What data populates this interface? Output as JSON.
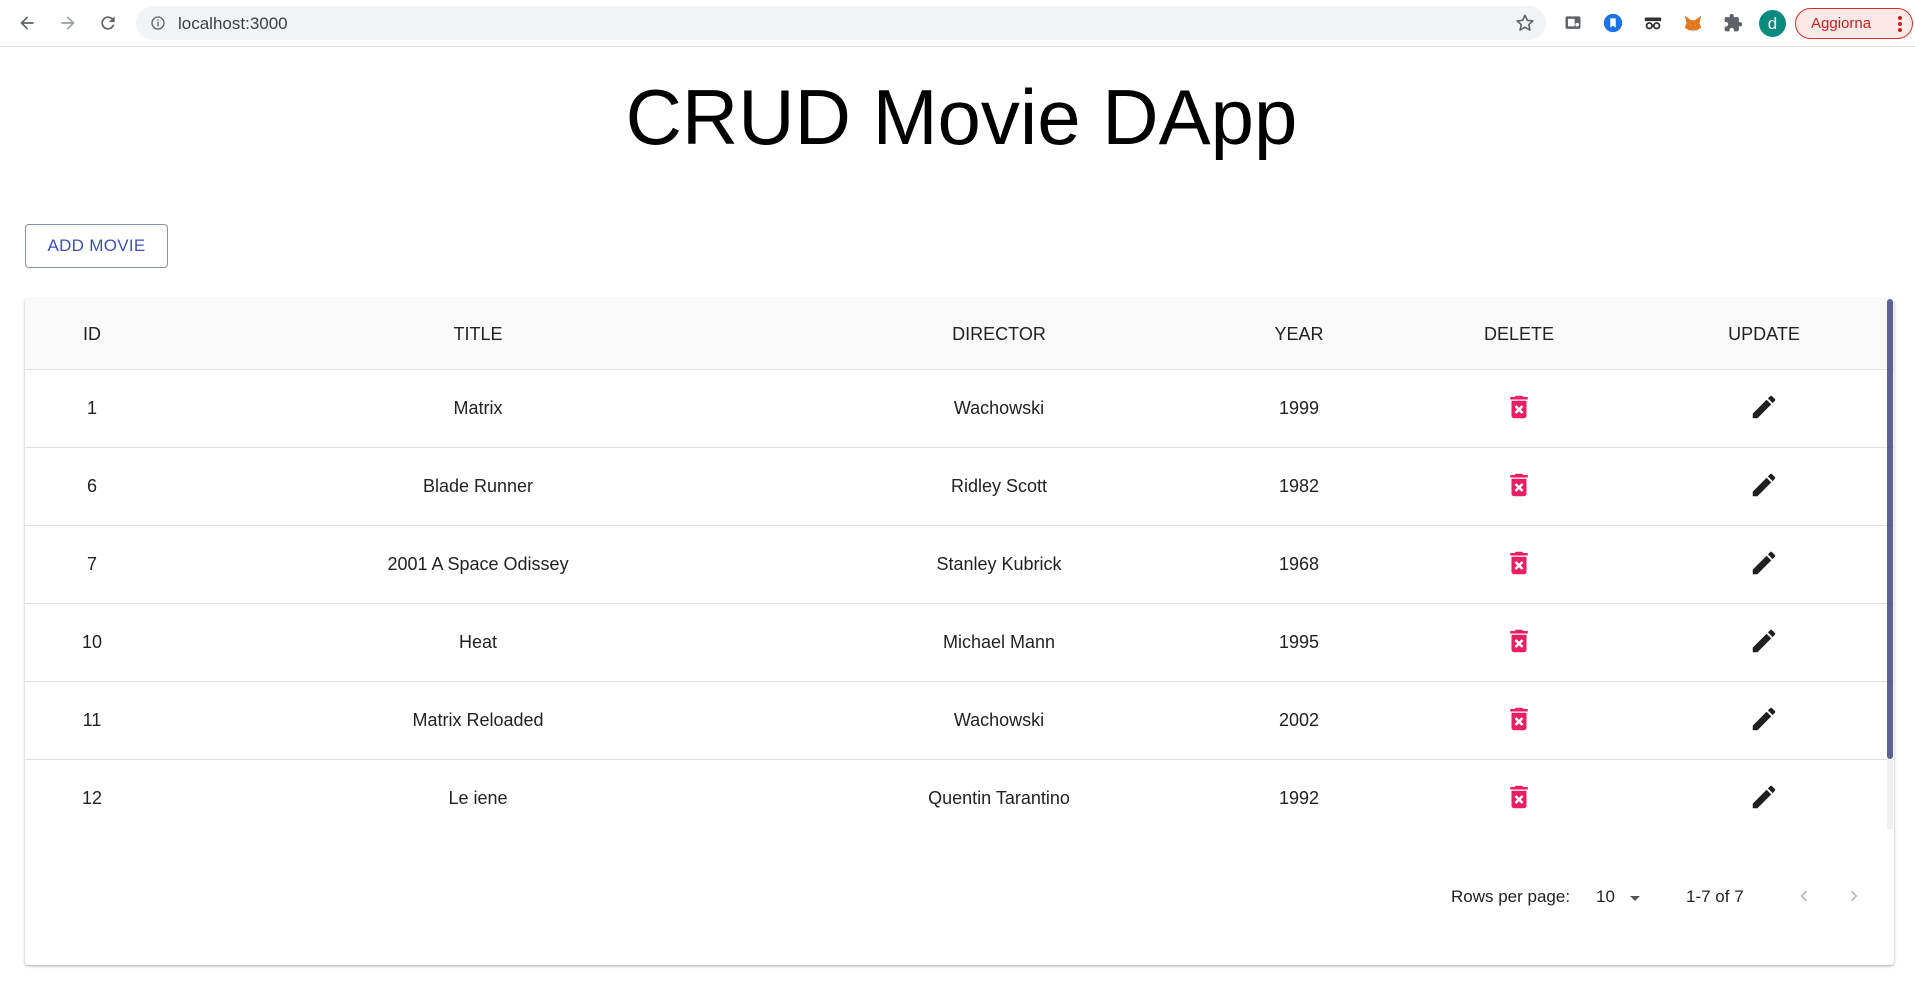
{
  "browser": {
    "url": "localhost:3000",
    "profile_initial": "d",
    "update_label": "Aggiorna"
  },
  "page": {
    "title": "CRUD Movie DApp",
    "add_button_label": "ADD MOVIE"
  },
  "table": {
    "columns": [
      "ID",
      "TITLE",
      "DIRECTOR",
      "YEAR",
      "DELETE",
      "UPDATE"
    ],
    "rows": [
      {
        "id": "1",
        "title": "Matrix",
        "director": "Wachowski",
        "year": "1999"
      },
      {
        "id": "6",
        "title": "Blade Runner",
        "director": "Ridley Scott",
        "year": "1982"
      },
      {
        "id": "7",
        "title": "2001 A Space Odissey",
        "director": "Stanley Kubrick",
        "year": "1968"
      },
      {
        "id": "10",
        "title": "Heat",
        "director": "Michael Mann",
        "year": "1995"
      },
      {
        "id": "11",
        "title": "Matrix Reloaded",
        "director": "Wachowski",
        "year": "2002"
      },
      {
        "id": "12",
        "title": "Le iene",
        "director": "Quentin Tarantino",
        "year": "1992"
      }
    ],
    "delete_icon": "delete-forever-icon",
    "update_icon": "edit-pencil-icon",
    "delete_color": "#e91e63"
  },
  "pagination": {
    "rows_per_page_label": "Rows per page:",
    "rows_per_page_value": "10",
    "range_label": "1-7 of 7"
  }
}
